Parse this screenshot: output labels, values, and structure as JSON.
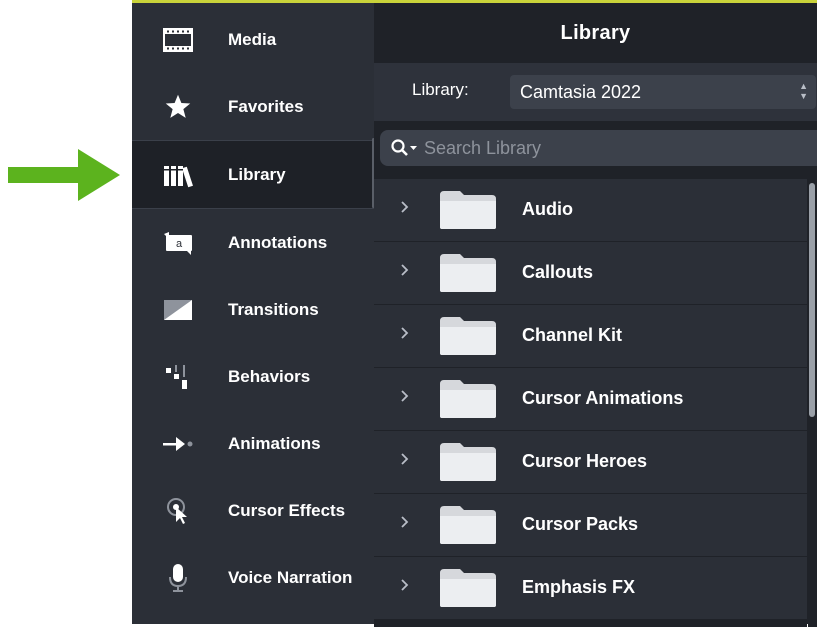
{
  "sidebar": {
    "items": [
      {
        "label": "Media",
        "icon": "film-strip-icon"
      },
      {
        "label": "Favorites",
        "icon": "star-icon"
      },
      {
        "label": "Library",
        "icon": "books-icon",
        "active": true
      },
      {
        "label": "Annotations",
        "icon": "speech-bubble-icon"
      },
      {
        "label": "Transitions",
        "icon": "transition-icon"
      },
      {
        "label": "Behaviors",
        "icon": "behaviors-icon"
      },
      {
        "label": "Animations",
        "icon": "arrow-dot-icon"
      },
      {
        "label": "Cursor Effects",
        "icon": "cursor-target-icon"
      },
      {
        "label": "Voice Narration",
        "icon": "microphone-icon"
      }
    ]
  },
  "panel": {
    "title": "Library",
    "library_label": "Library:",
    "library_value": "Camtasia 2022",
    "search_placeholder": "Search Library",
    "folders": [
      {
        "name": "Audio"
      },
      {
        "name": "Callouts"
      },
      {
        "name": "Channel Kit"
      },
      {
        "name": "Cursor Animations"
      },
      {
        "name": "Cursor Heroes"
      },
      {
        "name": "Cursor Packs"
      },
      {
        "name": "Emphasis FX"
      }
    ]
  },
  "colors": {
    "accent_arrow": "#5cb31e",
    "top_border": "#c9d33a",
    "sidebar_bg": "#2b2f37",
    "panel_bg": "#1f2228",
    "folder": "#d6d8dc"
  }
}
